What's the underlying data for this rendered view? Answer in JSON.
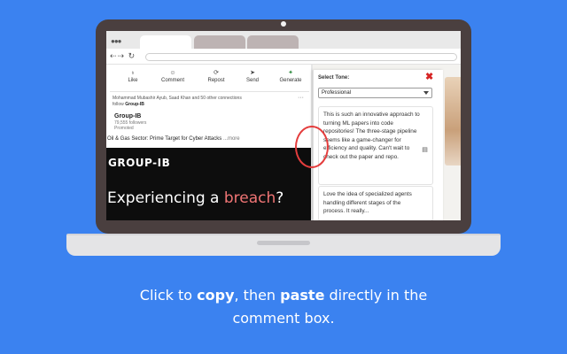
{
  "browser": {
    "dots": "●●●",
    "nav_icons": "⇠⇢ ↻"
  },
  "post": {
    "actions": [
      {
        "icon": "like-icon",
        "glyph": "♁",
        "label": "Like"
      },
      {
        "icon": "comment-icon",
        "glyph": "☺",
        "label": "Comment"
      },
      {
        "icon": "repost-icon",
        "glyph": "⟳",
        "label": "Repost"
      },
      {
        "icon": "send-icon",
        "glyph": "➤",
        "label": "Send"
      },
      {
        "icon": "generate-icon",
        "glyph": "✦",
        "label": "Generate"
      }
    ],
    "social_names": "Mohammad Mubashir Ayub, Saad Khan",
    "social_suffix": " and 50 other connections",
    "social_follow_prefix": "follow ",
    "social_follow_company": "Group-IB",
    "more_menu": "···",
    "company_name": "Group-IB",
    "company_followers": "79,555 followers",
    "company_promoted": "Promoted",
    "headline": "Oil & Gas Sector: Prime Target for Cyber Attacks",
    "headline_more": "...more",
    "banner_brand": "GROUP-IB",
    "banner_title_pre": "Experiencing a ",
    "banner_title_highlight": "breach",
    "banner_title_post": "?"
  },
  "extension": {
    "title": "Select Tone:",
    "close_glyph": "✖",
    "tone_selected": "Professional",
    "comments": [
      "This is such an innovative approach to turning ML papers into code repositories! The three-stage pipeline seems like a game-changer for efficiency and quality. Can't wait to check out the paper and repo.",
      "Love the idea of specialized agents handling different stages of the process. It really..."
    ],
    "copy_glyph": "▤"
  },
  "caption": {
    "part1": "Click to ",
    "bold1": "copy",
    "part2": ", then ",
    "bold2": "paste",
    "part3": " directly in the",
    "line2": "comment box."
  },
  "colors": {
    "background": "#3b82f0",
    "laptop_lid": "#4a3f3f",
    "close_red": "#d62424",
    "highlight_ring": "#e43d3d",
    "banner_highlight": "#f07575"
  }
}
